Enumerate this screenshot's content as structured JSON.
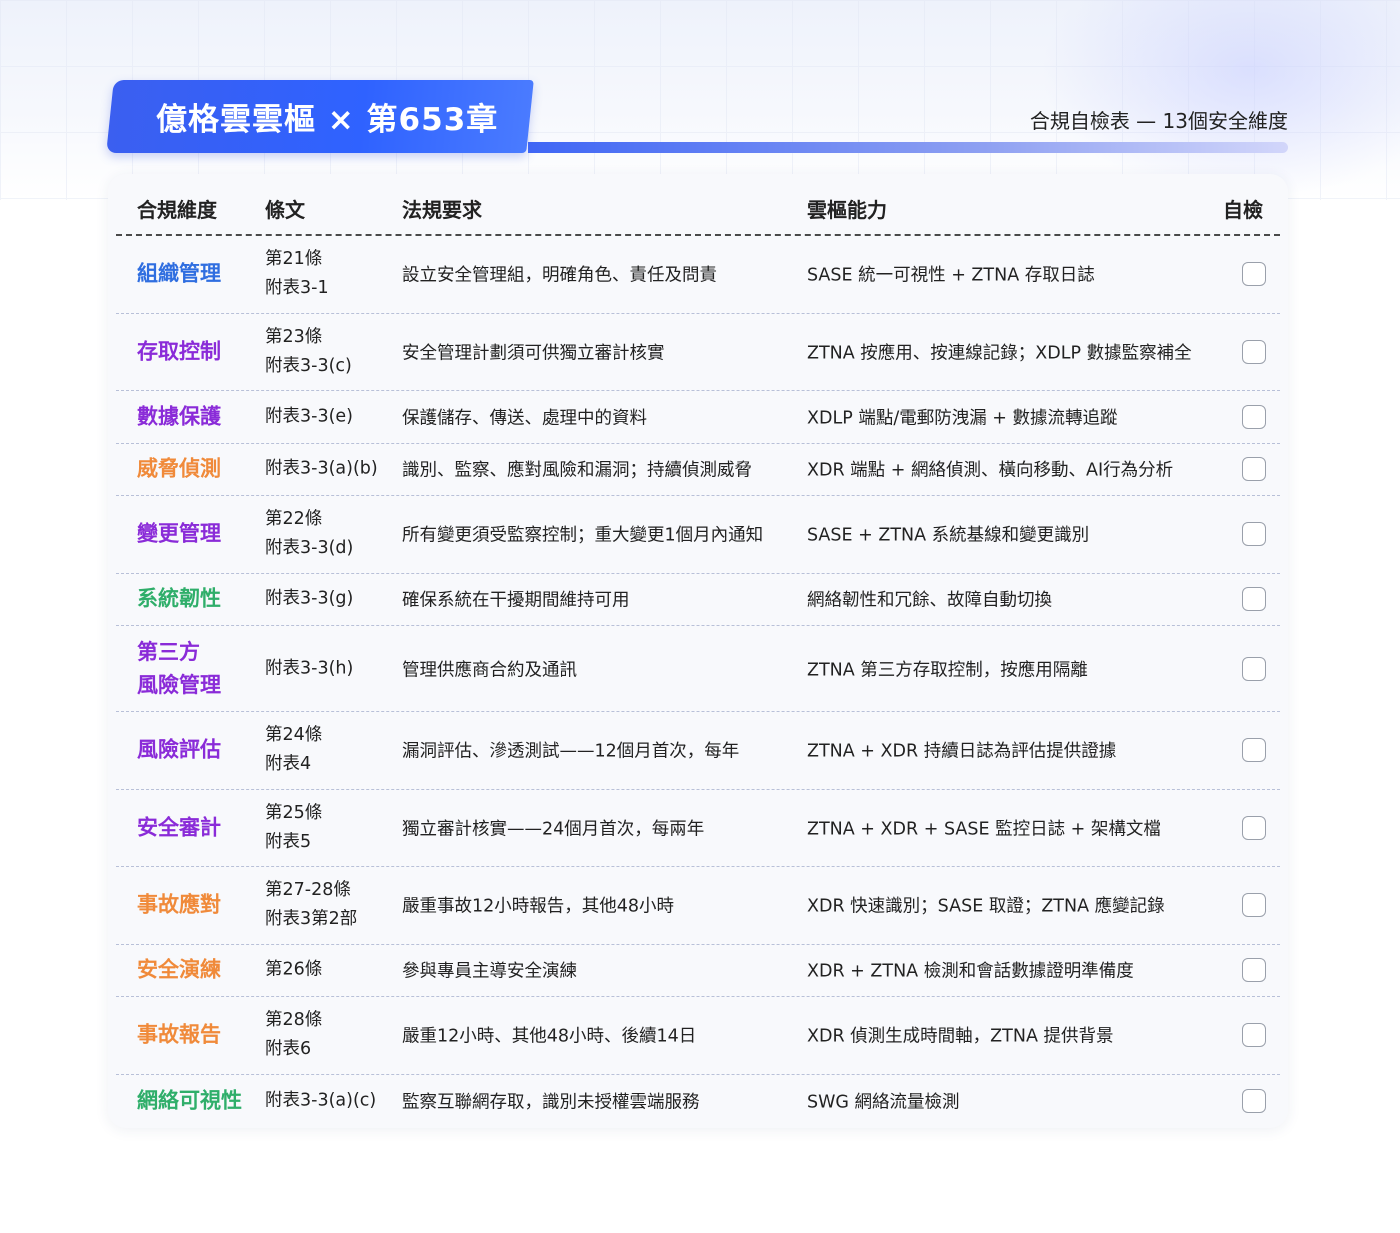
{
  "header": {
    "title": "億格雲雲樞 × 第653章",
    "subtitle": "合規自檢表 — 13個安全維度"
  },
  "table": {
    "columns": [
      "合規維度",
      "條文",
      "法規要求",
      "雲樞能力",
      "自檢"
    ],
    "rows": [
      {
        "dimension": [
          "組織管理"
        ],
        "color": "#2f6ee0",
        "articles": [
          "第21條",
          "附表3-1"
        ],
        "requirement": "設立安全管理組，明確角色、責任及問責",
        "capability": "SASE 統一可視性 + ZTNA 存取日誌",
        "checked": false
      },
      {
        "dimension": [
          "存取控制"
        ],
        "color": "#8a2bd8",
        "articles": [
          "第23條",
          "附表3-3(c)"
        ],
        "requirement": "安全管理計劃須可供獨立審計核實",
        "capability": "ZTNA 按應用、按連線記錄；XDLP 數據監察補全",
        "checked": false
      },
      {
        "dimension": [
          "數據保護"
        ],
        "color": "#8a2bd8",
        "articles": [
          "附表3-3(e)"
        ],
        "requirement": "保護儲存、傳送、處理中的資料",
        "capability": "XDLP 端點/電郵防洩漏 + 數據流轉追蹤",
        "checked": false
      },
      {
        "dimension": [
          "威脅偵測"
        ],
        "color": "#f08a3a",
        "articles": [
          "附表3-3(a)(b)"
        ],
        "requirement": "識別、監察、應對風險和漏洞；持續偵測威脅",
        "capability": "XDR 端點 + 網絡偵測、橫向移動、AI行為分析",
        "checked": false
      },
      {
        "dimension": [
          "變更管理"
        ],
        "color": "#8a2bd8",
        "articles": [
          "第22條",
          "附表3-3(d)"
        ],
        "requirement": "所有變更須受監察控制；重大變更1個月內通知",
        "capability": "SASE + ZTNA 系統基線和變更識別",
        "checked": false
      },
      {
        "dimension": [
          "系統韌性"
        ],
        "color": "#2fae6a",
        "articles": [
          "附表3-3(g)"
        ],
        "requirement": "確保系統在干擾期間維持可用",
        "capability": "網絡韌性和冗餘、故障自動切換",
        "checked": false
      },
      {
        "dimension": [
          "第三方",
          "風險管理"
        ],
        "color": "#8a2bd8",
        "articles": [
          "附表3-3(h)"
        ],
        "requirement": "管理供應商合約及通訊",
        "capability": "ZTNA 第三方存取控制，按應用隔離",
        "checked": false
      },
      {
        "dimension": [
          "風險評估"
        ],
        "color": "#8a2bd8",
        "articles": [
          "第24條",
          "附表4"
        ],
        "requirement": "漏洞評估、滲透測試——12個月首次，每年",
        "capability": "ZTNA + XDR 持續日誌為評估提供證據",
        "checked": false
      },
      {
        "dimension": [
          "安全審計"
        ],
        "color": "#8a2bd8",
        "articles": [
          "第25條",
          "附表5"
        ],
        "requirement": "獨立審計核實——24個月首次，每兩年",
        "capability": "ZTNA + XDR + SASE 監控日誌 + 架構文檔",
        "checked": false
      },
      {
        "dimension": [
          "事故應對"
        ],
        "color": "#f08a3a",
        "articles": [
          "第27-28條",
          "附表3第2部"
        ],
        "requirement": "嚴重事故12小時報告，其他48小時",
        "capability": "XDR 快速識別；SASE 取證；ZTNA 應變記錄",
        "checked": false
      },
      {
        "dimension": [
          "安全演練"
        ],
        "color": "#f08a3a",
        "articles": [
          "第26條"
        ],
        "requirement": "參與專員主導安全演練",
        "capability": "XDR + ZTNA 檢測和會話數據證明準備度",
        "checked": false
      },
      {
        "dimension": [
          "事故報告"
        ],
        "color": "#f08a3a",
        "articles": [
          "第28條",
          "附表6"
        ],
        "requirement": "嚴重12小時、其他48小時、後續14日",
        "capability": "XDR 偵測生成時間軸，ZTNA 提供背景",
        "checked": false
      },
      {
        "dimension": [
          "網絡可視性"
        ],
        "color": "#2fae6a",
        "articles": [
          "附表3-3(a)(c)"
        ],
        "requirement": "監察互聯網存取，識別未授權雲端服務",
        "capability": "SWG 網絡流量檢測",
        "checked": false
      }
    ]
  }
}
